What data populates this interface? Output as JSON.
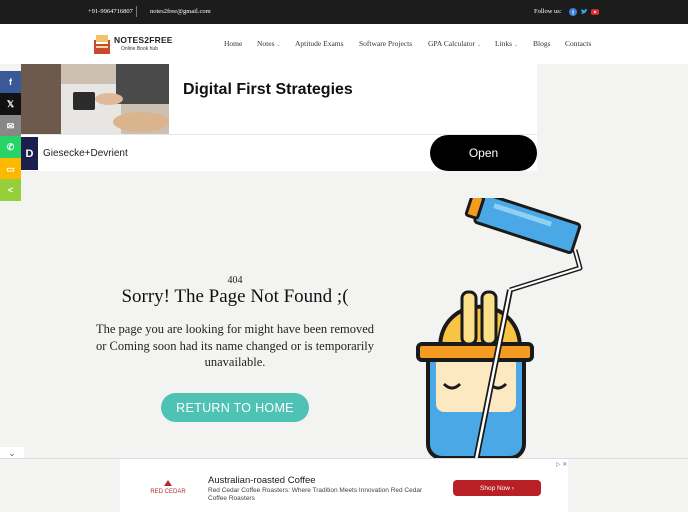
{
  "topbar": {
    "phone": "+91-9964716807",
    "email": "notes2free@gmail.com",
    "follow_label": "Follow us:",
    "social_icons": [
      "facebook-icon",
      "twitter-icon",
      "youtube-icon"
    ]
  },
  "logo": {
    "title": "NOTES2FREE",
    "subtitle": "Online Book hub"
  },
  "nav": [
    {
      "label": "Home",
      "dropdown": false
    },
    {
      "label": "Notes",
      "dropdown": true
    },
    {
      "label": "Aptitude Exams",
      "dropdown": false
    },
    {
      "label": "Software Projects",
      "dropdown": false
    },
    {
      "label": "GPA Calculator",
      "dropdown": true
    },
    {
      "label": "Links",
      "dropdown": true
    },
    {
      "label": "Blogs",
      "dropdown": false
    },
    {
      "label": "Contacts",
      "dropdown": false
    }
  ],
  "share_bar": [
    {
      "icon": "facebook-icon",
      "glyph": "f",
      "color": "#3b5998"
    },
    {
      "icon": "x-twitter-icon",
      "glyph": "𝕏",
      "color": "#111111"
    },
    {
      "icon": "email-icon",
      "glyph": "✉",
      "color": "#888888"
    },
    {
      "icon": "whatsapp-icon",
      "glyph": "✆",
      "color": "#25d366"
    },
    {
      "icon": "sms-icon",
      "glyph": "▭",
      "color": "#fcb900"
    },
    {
      "icon": "share-icon",
      "glyph": "<",
      "color": "#95d03a"
    }
  ],
  "ad_top": {
    "headline": "Digital First Strategies",
    "brand_logo": "D",
    "brand": "Giesecke+Devrient",
    "cta": "Open"
  },
  "error": {
    "code": "404",
    "title": "Sorry! The Page Not Found ;(",
    "description": "The page you are looking for might have been removed or Coming soon had its name changed or is temporarily unavailable.",
    "button": "RETURN TO HOME"
  },
  "collapse_icon": "chevron-down-icon",
  "collapse_glyph": "⌄",
  "ad_bottom": {
    "logo_text": "RED CEDAR",
    "title": "Australian-roasted Coffee",
    "description": "Red Cedar Coffee Roasters: Where Tradition Meets Innovation Red Cedar Coffee Roasters",
    "cta": "Shop Now",
    "cta_glyph": "›",
    "adchoices": "▷ ✕"
  }
}
